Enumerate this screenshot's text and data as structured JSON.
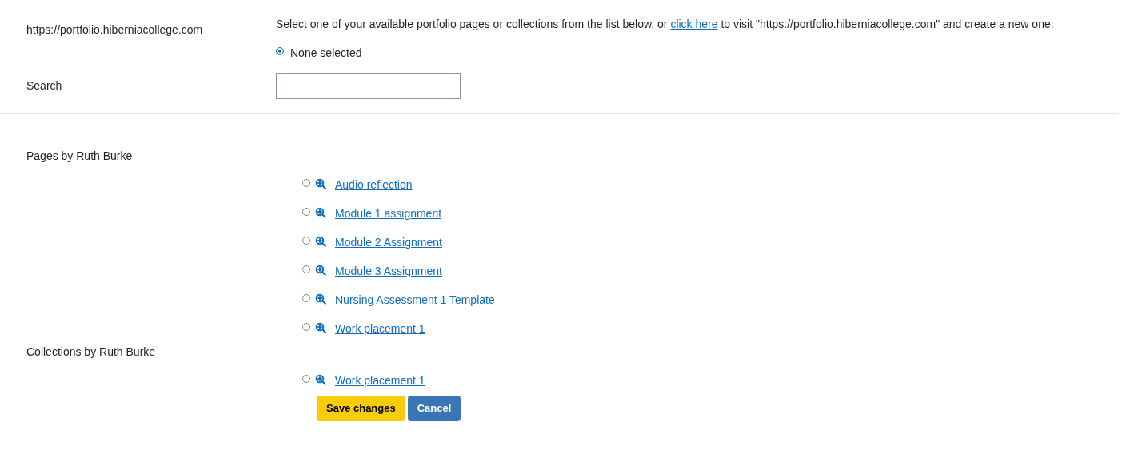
{
  "site": {
    "label": "https://portfolio.hiberniacollege.com",
    "intro_before": "Select one of your available portfolio pages or collections from the list below, or",
    "intro_link": "click here",
    "intro_after": "to visit \"https://portfolio.hiberniacollege.com\" and create a new one."
  },
  "none_option": {
    "label": "None selected",
    "selected": true
  },
  "search": {
    "label": "Search"
  },
  "groups": [
    {
      "label": "Pages by Ruth Burke",
      "items": [
        {
          "label": "Audio reflection",
          "selected": false
        },
        {
          "label": "Module 1 assignment",
          "selected": false
        },
        {
          "label": "Module 2 Assignment",
          "selected": false
        },
        {
          "label": "Module 3 Assignment",
          "selected": false
        },
        {
          "label": "Nursing Assessment 1 Template",
          "selected": false
        },
        {
          "label": "Work placement 1",
          "selected": false
        }
      ]
    },
    {
      "label": "Collections by Ruth Burke",
      "items": [
        {
          "label": "Work placement 1",
          "selected": false
        }
      ]
    }
  ],
  "buttons": [
    {
      "label": "Save changes",
      "kind": "primary"
    },
    {
      "label": "Cancel",
      "kind": "secondary"
    }
  ]
}
